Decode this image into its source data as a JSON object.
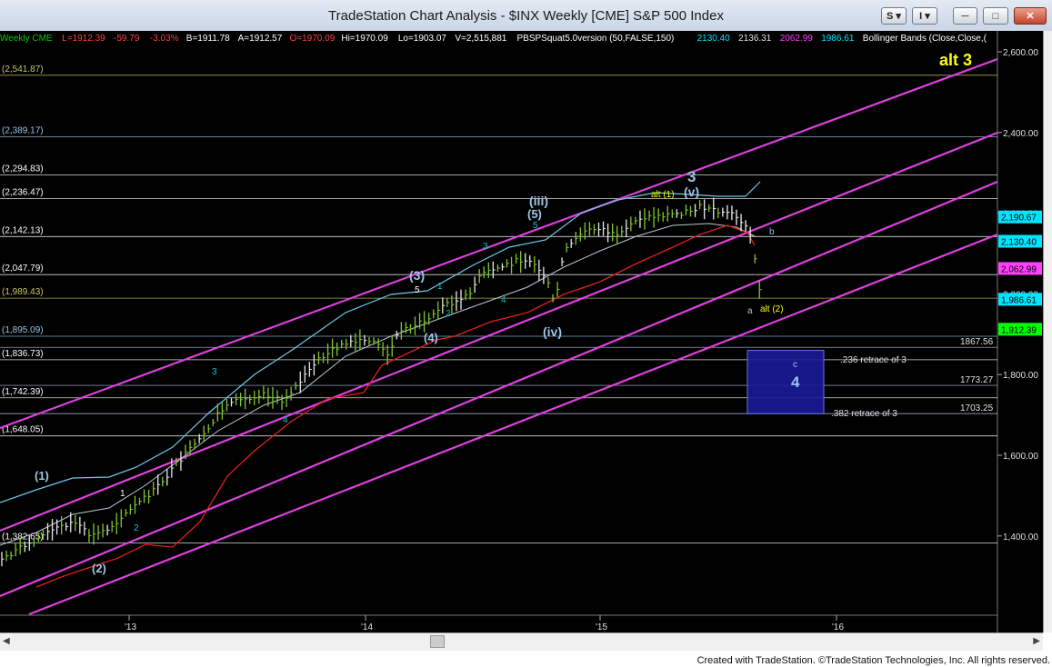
{
  "window": {
    "title": "TradeStation Chart Analysis - $INX Weekly [CME] S&P 500 Index",
    "btn_style": "S",
    "btn_indicator": "I",
    "btn_minimize": "─",
    "btn_maximize": "□",
    "btn_close": "✕"
  },
  "header_stats": [
    {
      "text": "Weekly  CME",
      "color": "#00cc00"
    },
    {
      "text": "L=1912.39",
      "color": "#ff4040"
    },
    {
      "text": "-59.79",
      "color": "#ff4040"
    },
    {
      "text": "-3.03%",
      "color": "#ff4040"
    },
    {
      "text": "B=1911.78",
      "color": "#ffffff"
    },
    {
      "text": "A=1912.57",
      "color": "#ffffff"
    },
    {
      "text": "O=1970.09",
      "color": "#ff4040"
    },
    {
      "text": "Hi=1970.09",
      "color": "#ffffff"
    },
    {
      "text": "Lo=1903.07",
      "color": "#ffffff"
    },
    {
      "text": "V=2,515,881",
      "color": "#ffffff"
    },
    {
      "text": "PBSPSquat5.0version (50,FALSE,150)",
      "color": "#ffffff"
    },
    {
      "text": "2130.40",
      "color": "#00e5ff"
    },
    {
      "text": "2136.31",
      "color": "#e0e0e0"
    },
    {
      "text": "2062.99",
      "color": "#ff40ff"
    },
    {
      "text": "1986.61",
      "color": "#00e5ff"
    },
    {
      "text": "Bollinger Bands (Close,Close,(",
      "color": "#ffffff"
    }
  ],
  "chart_data": {
    "type": "candlestick",
    "symbol": "$INX",
    "interval": "Weekly",
    "x_ticks": [
      "'13",
      "'14",
      "'15",
      "'16"
    ],
    "y_ticks": [
      "2,600.00",
      "2,400.00",
      "2,200.00",
      "2,000.00",
      "1,800.00",
      "1,600.00",
      "1,400.00"
    ],
    "fib_levels": [
      {
        "label": "(2,541.87)",
        "value": 2541.87,
        "color": "#c8c864"
      },
      {
        "label": "(2,389.17)",
        "value": 2389.17,
        "color": "#9fc5e8"
      },
      {
        "label": "(2,294.83)",
        "value": 2294.83,
        "color": "#ffffff"
      },
      {
        "label": "(2,236.47)",
        "value": 2236.47,
        "color": "#ffffff"
      },
      {
        "label": "(2,142.13)",
        "value": 2142.13,
        "color": "#ffffff"
      },
      {
        "label": "(2,047.79)",
        "value": 2047.79,
        "color": "#ffffff"
      },
      {
        "label": "(1,989.43)",
        "value": 1989.43,
        "color": "#c8c864"
      },
      {
        "label": "(1,895.09)",
        "value": 1895.09,
        "color": "#9fc5e8"
      },
      {
        "label": "(1,836.73)",
        "value": 1836.73,
        "color": "#ffffff"
      },
      {
        "label": "(1,742.39)",
        "value": 1742.39,
        "color": "#ffffff"
      },
      {
        "label": "(1,648.05)",
        "value": 1648.05,
        "color": "#ffffff"
      },
      {
        "label": "(1,382.65)",
        "value": 1382.65,
        "color": "#ffffff"
      }
    ],
    "target_levels": [
      {
        "label": "1867.56",
        "value": 1867.56
      },
      {
        "label": "1773.27",
        "value": 1773.27
      },
      {
        "label": "1703.25",
        "value": 1703.25
      }
    ],
    "price_tags": [
      {
        "label": "2,190.67",
        "value": 2190.67,
        "bg": "#00e5ff",
        "fg": "#000000"
      },
      {
        "label": "2,130.40",
        "value": 2130.4,
        "bg": "#00e5ff",
        "fg": "#000000"
      },
      {
        "label": "2,062.99",
        "value": 2062.99,
        "bg": "#ff40ff",
        "fg": "#000000"
      },
      {
        "label": "1,986.61",
        "value": 1986.61,
        "bg": "#00e5ff",
        "fg": "#000000"
      },
      {
        "label": "1,912.39",
        "value": 1912.39,
        "bg": "#00ff00",
        "fg": "#000000"
      }
    ],
    "retrace_labels": [
      ".236 retrace of 3",
      ".382 retrace of 3"
    ],
    "wave_labels": [
      {
        "text": "alt 3",
        "color": "#ffff00"
      },
      {
        "text": "3",
        "color": "#9fc5e8"
      },
      {
        "text": "(v)",
        "color": "#9fc5e8"
      },
      {
        "text": "alt (1)",
        "color": "#ffff00"
      },
      {
        "text": "(iii)",
        "color": "#9fc5e8"
      },
      {
        "text": "(5)",
        "color": "#9fc5e8"
      },
      {
        "text": "5",
        "color": "#00cccc"
      },
      {
        "text": "3",
        "color": "#00cccc"
      },
      {
        "text": "4",
        "color": "#00cccc"
      },
      {
        "text": "(iv)",
        "color": "#9fc5e8"
      },
      {
        "text": "(3)",
        "color": "#9fc5e8"
      },
      {
        "text": "5",
        "color": "#ffffff"
      },
      {
        "text": "1",
        "color": "#00cccc"
      },
      {
        "text": "2",
        "color": "#00cccc"
      },
      {
        "text": "(4)",
        "color": "#9fc5e8"
      },
      {
        "text": "3",
        "color": "#00cccc"
      },
      {
        "text": "4",
        "color": "#00cccc"
      },
      {
        "text": "(1)",
        "color": "#9fc5e8"
      },
      {
        "text": "1",
        "color": "#ffffff"
      },
      {
        "text": "2",
        "color": "#00cccc"
      },
      {
        "text": "(2)",
        "color": "#9fc5e8"
      },
      {
        "text": "b",
        "color": "#9fc5e8"
      },
      {
        "text": "a",
        "color": "#9fc5e8"
      },
      {
        "text": "alt (2)",
        "color": "#ffff00"
      },
      {
        "text": "c",
        "color": "#9fc5e8"
      },
      {
        "text": "4",
        "color": "#9fc5e8"
      }
    ],
    "indicators": [
      "Bollinger Bands",
      "PBSPSquat5.0version (50,FALSE,150)"
    ],
    "last_price": 1912.39
  },
  "footer": "Created with TradeStation. ©TradeStation Technologies, Inc. All rights reserved."
}
